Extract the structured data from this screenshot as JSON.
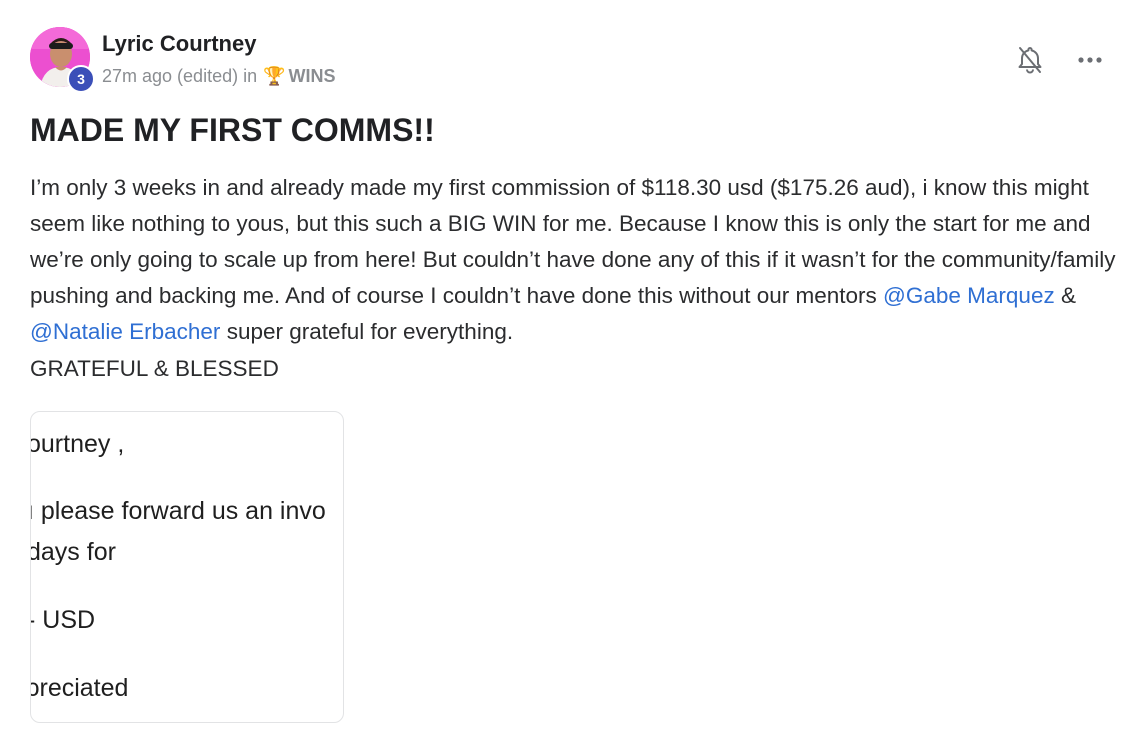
{
  "post": {
    "author": {
      "name": "Lyric Courtney",
      "level": "3"
    },
    "meta": {
      "time": "27m ago (edited)",
      "in_label": "in",
      "category_icon": "🏆",
      "category": "WINS"
    },
    "title": "MADE MY FIRST COMMS!!",
    "body": {
      "text_before": "I’m only 3 weeks in and already made my first commission of $118.30 usd ($175.26 aud), i know this might seem like nothing to yous, but this such a BIG WIN for me. Because I know this is only the start for me and we’re only going to scale up from here! But couldn’t have done any of this if it wasn’t for the community/family pushing and backing me. And of course I couldn’t have done this without our mentors ",
      "mention1": "@Gabe Marquez",
      "between": " & ",
      "mention2": "@Natalie Erbacher",
      "text_after": " super grateful for everything.",
      "line2": "GRATEFUL & BLESSED"
    },
    "attachment": {
      "lines": [
        "ourtney ,",
        "ı please forward us an invo",
        " days for",
        "- USD",
        "ɔreciated"
      ]
    },
    "icons": {
      "bell": "bell-off-icon",
      "more": "more-horizontal-icon"
    },
    "colors": {
      "mention": "#2f6fd3",
      "level_badge": "#3b4fb8",
      "avatar_bg": "#ec4fd0",
      "meta": "#8a8d91"
    }
  }
}
